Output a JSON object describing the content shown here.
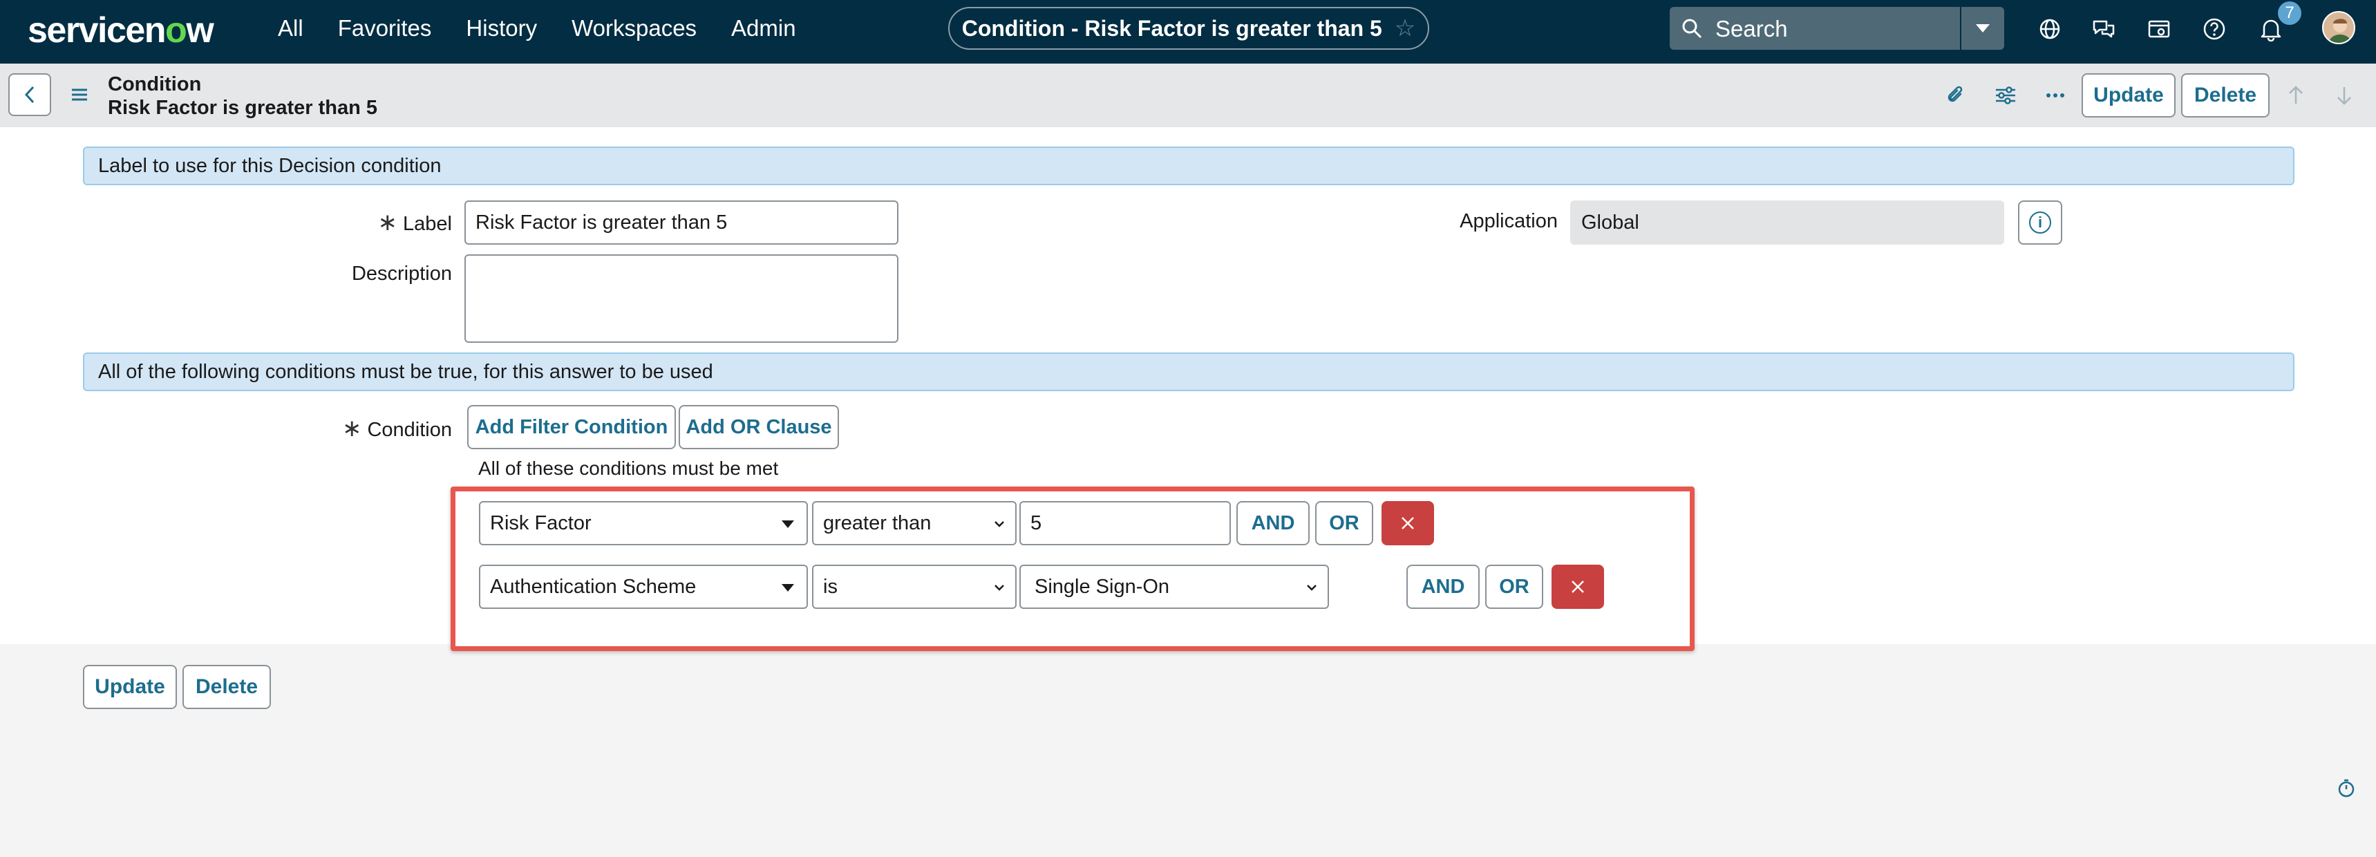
{
  "topnav": {
    "logo": {
      "pre": "servicen",
      "o": "o",
      "post": "w"
    },
    "menu": [
      "All",
      "Favorites",
      "History",
      "Workspaces",
      "Admin"
    ],
    "record_title": "Condition - Risk Factor is greater than 5",
    "search_placeholder": "Search",
    "notification_count": "7",
    "colors": {
      "bar": "#032d42",
      "logo_accent": "#62d84e",
      "badge": "#5ea4d1"
    }
  },
  "form_header": {
    "table_label": "Condition",
    "record_display": "Risk Factor is greater than 5",
    "update_label": "Update",
    "delete_label": "Delete"
  },
  "form": {
    "section1_title": "Label to use for this Decision condition",
    "label_field": {
      "label": "Label",
      "value": "Risk Factor is greater than 5"
    },
    "description_field": {
      "label": "Description",
      "value": ""
    },
    "application_field": {
      "label": "Application",
      "value": "Global"
    },
    "section2_title": "All of the following conditions must be true, for this answer to be used",
    "condition_label": "Condition",
    "add_filter_label": "Add Filter Condition",
    "add_or_label": "Add OR Clause",
    "all_met_text": "All of these conditions must be met",
    "conditions": [
      {
        "field": "Risk Factor",
        "operator": "greater than",
        "value": "5",
        "and": "AND",
        "or": "OR"
      },
      {
        "field": "Authentication Scheme",
        "operator": "is",
        "value": "Single Sign-On",
        "and": "AND",
        "or": "OR"
      }
    ],
    "highlight_color": "#e8574d"
  },
  "footer": {
    "update_label": "Update",
    "delete_label": "Delete"
  }
}
